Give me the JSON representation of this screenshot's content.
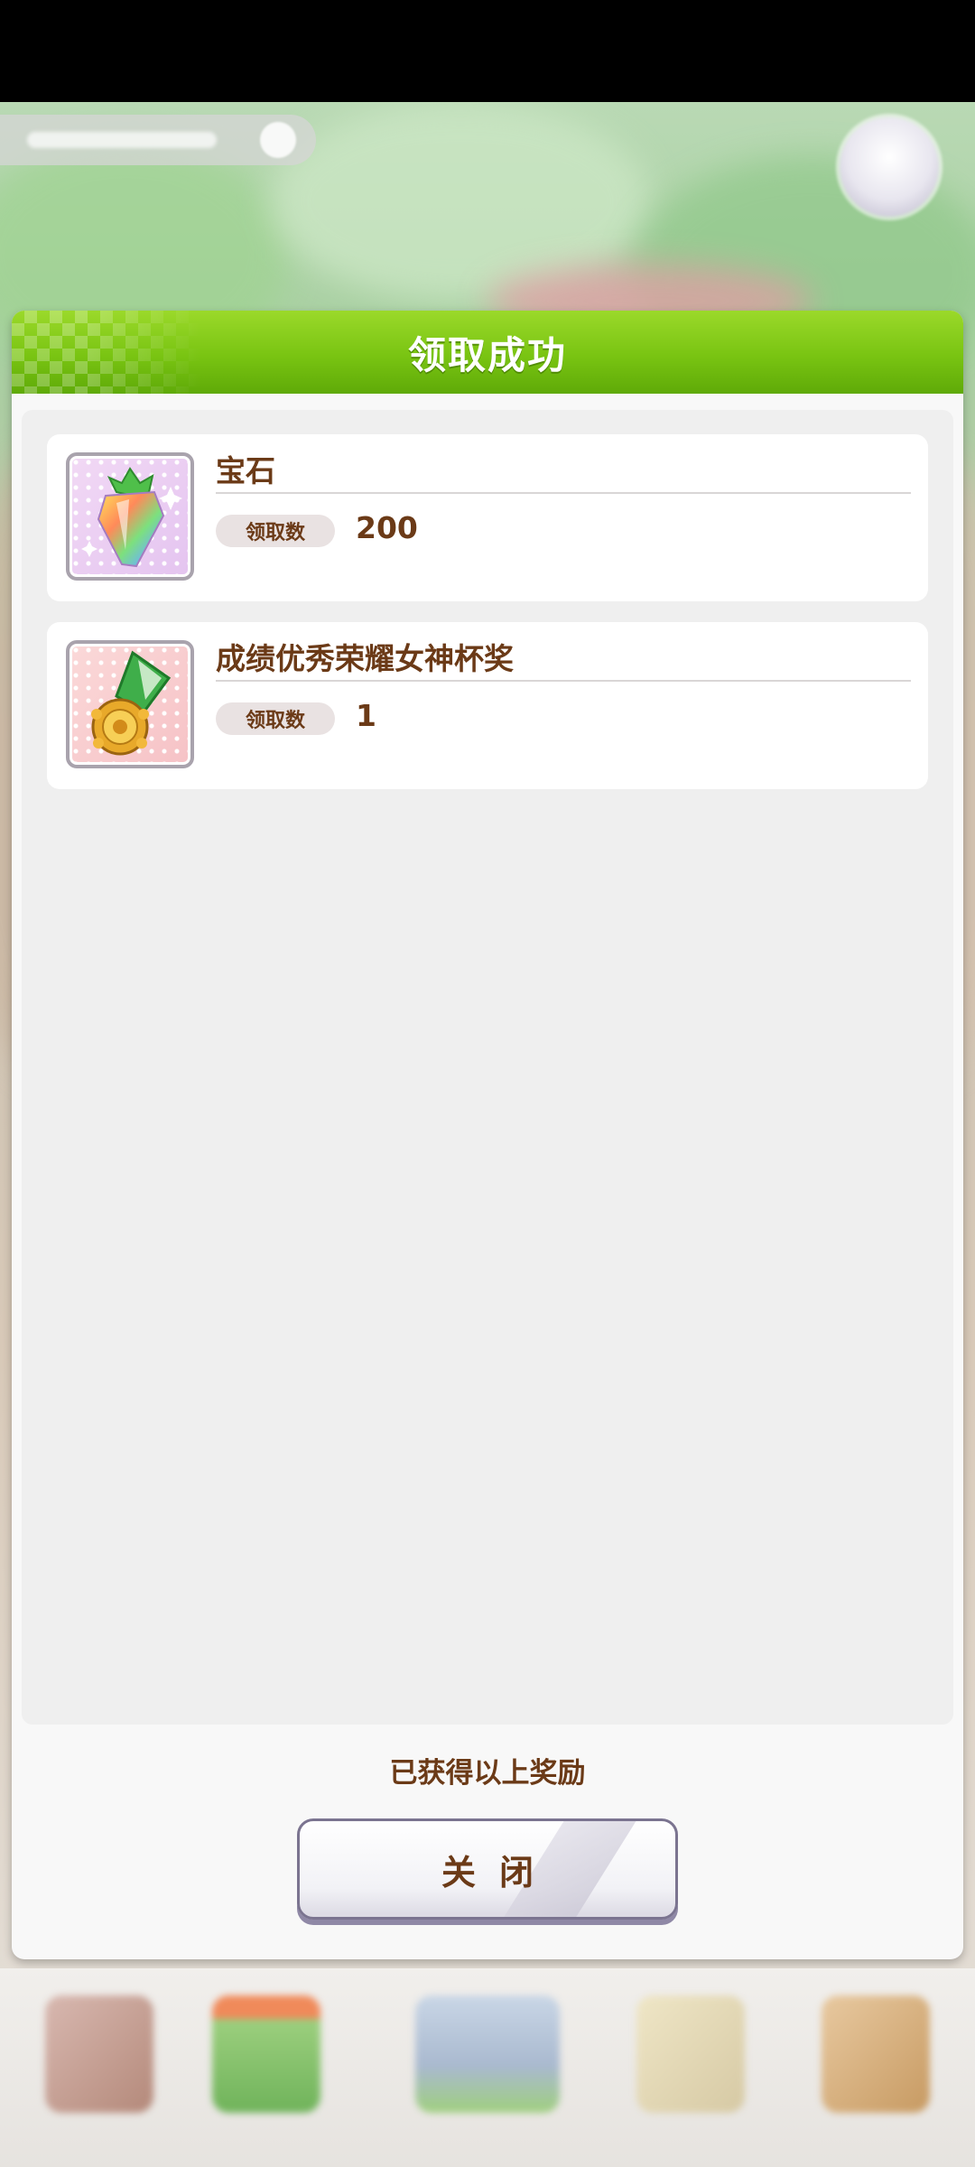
{
  "dialog": {
    "title": "领取成功",
    "rewards": [
      {
        "name": "宝石",
        "qty_label": "领取数",
        "qty": "200",
        "icon": "rainbow-gem-icon"
      },
      {
        "name": "成绩优秀荣耀女神杯奖",
        "qty_label": "领取数",
        "qty": "1",
        "icon": "green-ribbon-medal-icon"
      }
    ],
    "footer_text": "已获得以上奖励",
    "close_label": "关闭"
  },
  "colors": {
    "header_green": "#79c412",
    "text_brown": "#6b3a17",
    "panel_gray": "#efefef"
  }
}
